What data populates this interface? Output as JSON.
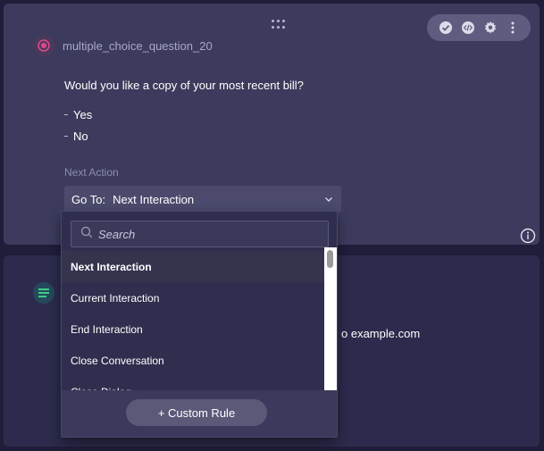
{
  "card1": {
    "title": "multiple_choice_question_20",
    "question": "Would you like a copy of your most recent bill?",
    "answers": [
      "Yes",
      "No"
    ],
    "next_action_label": "Next Action",
    "goto_label": "Go To:",
    "goto_value": "Next Interaction",
    "toolbar_icons": [
      "check-circle-icon",
      "code-icon",
      "gear-icon",
      "more-vertical-icon"
    ]
  },
  "card2": {
    "text_fragment": "o example.com"
  },
  "dropdown": {
    "search_placeholder": "Search",
    "options": [
      "Next Interaction",
      "Current Interaction",
      "End Interaction",
      "Close Conversation",
      "Close Dialog"
    ],
    "selected_index": 0,
    "custom_rule_label": "+ Custom Rule"
  },
  "colors": {
    "accent_pink": "#e0458c",
    "accent_green": "#3fc98a",
    "card_bg": "#3c3b5d",
    "page_bg": "#1f1e3a"
  }
}
